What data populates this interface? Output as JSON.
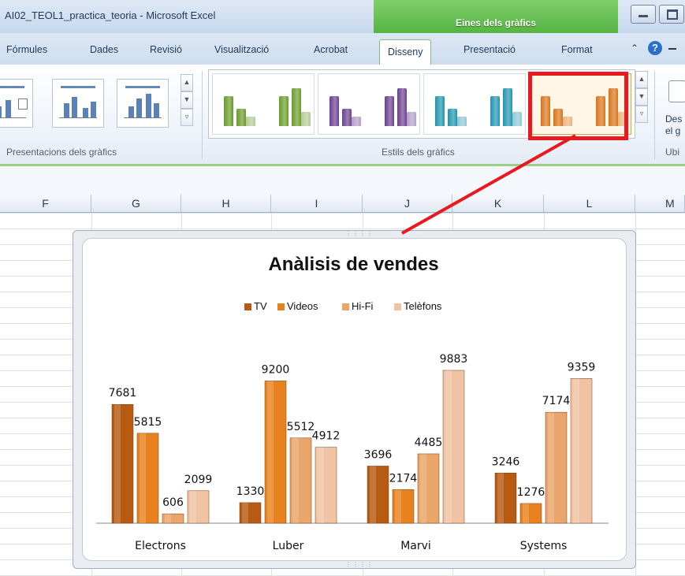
{
  "window": {
    "title": "AI02_TEOL1_practica_teoria - Microsoft Excel",
    "context_tab_group": "Eines dels gràfics"
  },
  "tabs": [
    "Fórmules",
    "Dades",
    "Revisió",
    "Visualització",
    "Acrobat",
    "Disseny",
    "Presentació",
    "Format"
  ],
  "active_tab": "Disseny",
  "ribbon": {
    "groups": {
      "layouts": "Presentacions dels gràfics",
      "styles": "Estils dels gràfics",
      "location": "Ubi"
    },
    "partial_button_label_line1": "Des",
    "partial_button_label_line2": "el g",
    "style_colors": [
      "#6a9a2a",
      "#6a3f8f",
      "#1f93ad",
      "#d8741a"
    ],
    "selected_style_index": 3
  },
  "columns": [
    "F",
    "G",
    "H",
    "I",
    "J",
    "K",
    "L",
    "M"
  ],
  "chart_data": {
    "type": "bar",
    "title": "Anàlisis de vendes",
    "legend_position": "top",
    "categories": [
      "Electrons",
      "Luber",
      "Marvi",
      "Systems"
    ],
    "series": [
      {
        "name": "TV",
        "values": [
          7681,
          1330,
          3696,
          3246
        ],
        "color": "#b75a12"
      },
      {
        "name": "Videos",
        "values": [
          5815,
          9200,
          2174,
          1276
        ],
        "color": "#e8821f"
      },
      {
        "name": "Hi-Fi",
        "values": [
          606,
          5512,
          4485,
          7174
        ],
        "color": "#e9a56a"
      },
      {
        "name": "Telèfons",
        "values": [
          2099,
          4912,
          9883,
          9359
        ],
        "color": "#f0c3a4"
      }
    ],
    "ylim": [
      0,
      9883
    ],
    "grid": false
  }
}
